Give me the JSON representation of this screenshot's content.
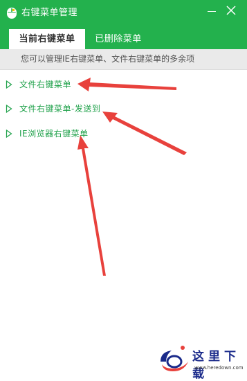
{
  "window": {
    "title": "右键菜单管理",
    "icon": "mouse-icon",
    "controls": [
      "minimize-icon",
      "close-icon"
    ]
  },
  "tabs": [
    {
      "label": "当前右键菜单",
      "active": true
    },
    {
      "label": "已删除菜单",
      "active": false
    }
  ],
  "hint": "您可以管理IE右键菜单、文件右键菜单的多余项",
  "tree": [
    {
      "label": "文件右键菜单",
      "icon": "expand-arrow-icon"
    },
    {
      "label": "文件右键菜单-发送到",
      "icon": "expand-arrow-icon"
    },
    {
      "label": "IE浏览器右键菜单",
      "icon": "expand-arrow-icon"
    }
  ],
  "watermark": {
    "text": "这里下载",
    "url": "www.heredown.com"
  },
  "colors": {
    "header_green": "#23b14d",
    "item_green": "#1fa14a",
    "arrow_red": "#e8413c",
    "hint_bg": "#eaeaea"
  }
}
